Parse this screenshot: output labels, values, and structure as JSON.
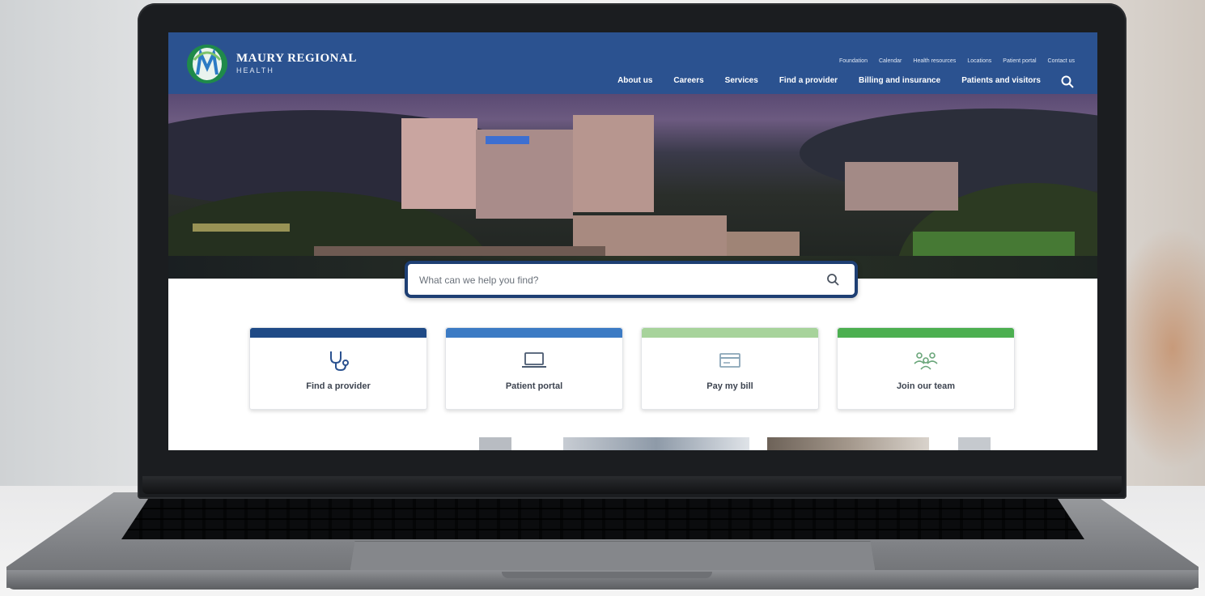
{
  "brand": {
    "name": "MAURY REGIONAL",
    "sub": "HEALTH",
    "colors": {
      "header": "#2b5290",
      "search_border": "#1e3f73"
    }
  },
  "utility_nav": [
    "Foundation",
    "Calendar",
    "Health resources",
    "Locations",
    "Patient portal",
    "Contact us"
  ],
  "main_nav": [
    "About us",
    "Careers",
    "Services",
    "Find a provider",
    "Billing and insurance",
    "Patients and visitors"
  ],
  "header_search_icon": "search-icon",
  "search": {
    "placeholder": "What can we help you find?",
    "icon": "search-icon"
  },
  "cards": [
    {
      "label": "Find a provider",
      "icon": "stethoscope-icon",
      "color": "#1f4a86"
    },
    {
      "label": "Patient portal",
      "icon": "laptop-icon",
      "color": "#3c7bc4"
    },
    {
      "label": "Pay my bill",
      "icon": "bill-icon",
      "color": "#a7d39b"
    },
    {
      "label": "Join our team",
      "icon": "team-icon",
      "color": "#4caf50"
    }
  ]
}
